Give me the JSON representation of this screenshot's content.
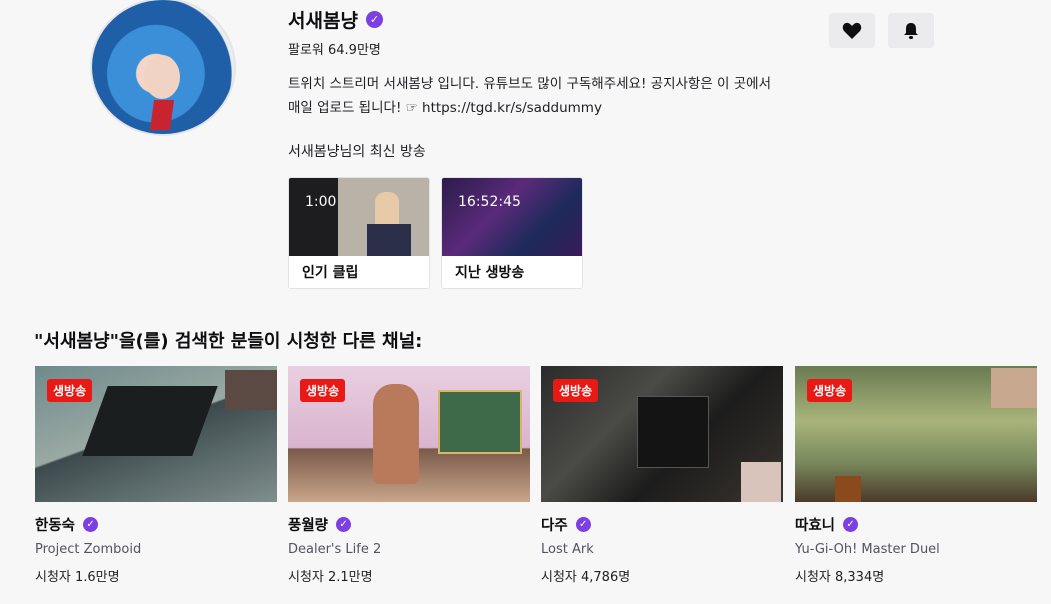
{
  "channel": {
    "name": "서새봄냥",
    "followers": "팔로워 64.9만명",
    "bio_line1": "트위치 스트리머 서새봄냥 입니다. 유튜브도 많이 구독해주세요! 공지사항은 이 곳에서",
    "bio_line2": "매일 업로드 됩니다! ☞ https://tgd.kr/s/saddummy"
  },
  "actions": {
    "follow_icon": "heart-icon",
    "notify_icon": "bell-icon"
  },
  "latest": {
    "title": "서새봄냥님의 최신 방송",
    "items": [
      {
        "duration": "1:00",
        "label": "인기 클립"
      },
      {
        "duration": "16:52:45",
        "label": "지난 생방송"
      }
    ]
  },
  "related": {
    "title": "\"서새봄냥\"을(를) 검색한 분들이 시청한 다른 채널:",
    "live_badge": "생방송",
    "channels": [
      {
        "name": "한동숙",
        "game": "Project Zomboid",
        "viewers": "시청자 1.6만명"
      },
      {
        "name": "풍월량",
        "game": "Dealer's Life 2",
        "viewers": "시청자 2.1만명"
      },
      {
        "name": "다주",
        "game": "Lost Ark",
        "viewers": "시청자 4,786명"
      },
      {
        "name": "따효니",
        "game": "Yu-Gi-Oh! Master Duel",
        "viewers": "시청자 8,334명"
      }
    ]
  },
  "colors": {
    "accent": "#7b3fe4",
    "live": "#e91916"
  }
}
